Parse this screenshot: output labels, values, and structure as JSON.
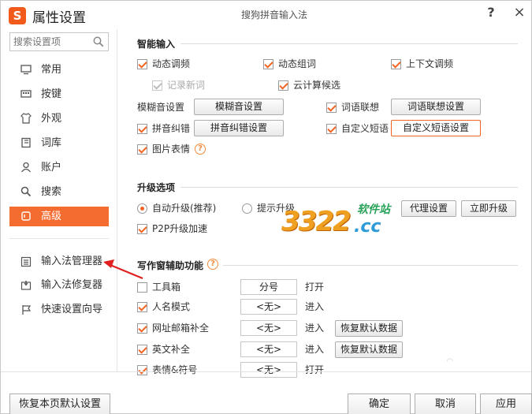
{
  "titlebar": {
    "logo_char": "S",
    "app_title": "属性设置",
    "center_title": "搜狗拼音输入法",
    "help": "?",
    "close": "×"
  },
  "sidebar": {
    "search_placeholder": "搜索设置项",
    "nav": [
      {
        "label": "常用",
        "icon": "monitor-icon"
      },
      {
        "label": "按键",
        "icon": "keyboard-icon"
      },
      {
        "label": "外观",
        "icon": "shirt-icon"
      },
      {
        "label": "词库",
        "icon": "book-icon"
      },
      {
        "label": "账户",
        "icon": "user-icon"
      },
      {
        "label": "搜索",
        "icon": "search-icon"
      },
      {
        "label": "高级",
        "icon": "advanced-icon",
        "active": true
      }
    ],
    "tools": [
      {
        "label": "输入法管理器",
        "icon": "list-icon"
      },
      {
        "label": "输入法修复器",
        "icon": "repair-icon"
      },
      {
        "label": "快速设置向导",
        "icon": "flag-icon"
      }
    ],
    "accent_color": "#f46c30"
  },
  "smart_input": {
    "title": "智能输入",
    "dynamic_freq": "动态调频",
    "dynamic_combine": "动态组词",
    "context_freq": "上下文调频",
    "record_new_words": "记录新词",
    "cloud_candidate": "云计算候选",
    "fuzzy_label": "模糊音设置",
    "fuzzy_btn": "模糊音设置",
    "word_assoc": "词语联想",
    "word_assoc_btn": "词语联想设置",
    "pinyin_correct": "拼音纠错",
    "pinyin_correct_btn": "拼音纠错设置",
    "custom_phrase": "自定义短语",
    "custom_phrase_btn": "自定义短语设置",
    "picture_emoji": "图片表情"
  },
  "upgrade": {
    "title": "升级选项",
    "auto_upgrade": "自动升级(推荐)",
    "prompt_upgrade": "提示升级",
    "proxy_btn": "代理设置",
    "upgrade_now_btn": "立即升级",
    "p2p": "P2P升级加速"
  },
  "writing": {
    "title": "写作窗辅助功能",
    "rows": [
      {
        "label": "工具箱",
        "field": "分号",
        "action": "打开",
        "checked": false
      },
      {
        "label": "人名模式",
        "field": "<无>",
        "action": "进入",
        "checked": true
      },
      {
        "label": "网址邮箱补全",
        "field": "<无>",
        "action": "进入",
        "checked": true,
        "restore": "恢复默认数据"
      },
      {
        "label": "英文补全",
        "field": "<无>",
        "action": "进入",
        "checked": true,
        "restore": "恢复默认数据"
      },
      {
        "label": "表情&符号",
        "field": "<无>",
        "action": "打开",
        "checked": true
      }
    ]
  },
  "watermark": {
    "text_top": "软件站",
    "text_main": "3322",
    "text_cc": ".cc"
  },
  "bottom": {
    "restore_defaults": "恢复本页默认设置",
    "ok": "确定",
    "cancel": "取消",
    "apply": "应用"
  }
}
